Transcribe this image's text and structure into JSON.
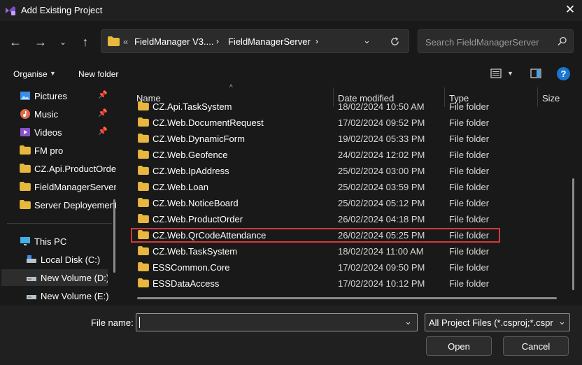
{
  "window": {
    "title": "Add Existing Project",
    "close_icon": "close-icon"
  },
  "nav": {
    "path_overflow": "«",
    "crumbs": [
      "FieldManager V3....",
      "FieldManagerServer"
    ],
    "search_placeholder": "Search FieldManagerServer"
  },
  "toolbar": {
    "organise": "Organise",
    "new_folder": "New folder"
  },
  "sidebar": {
    "items": [
      {
        "label": "Pictures",
        "icon": "pictures-icon",
        "pinned": true
      },
      {
        "label": "Music",
        "icon": "music-icon",
        "pinned": true
      },
      {
        "label": "Videos",
        "icon": "videos-icon",
        "pinned": true
      },
      {
        "label": "FM pro",
        "icon": "folder-icon",
        "pinned": false
      },
      {
        "label": "CZ.Api.ProductOrder",
        "icon": "folder-icon",
        "pinned": false
      },
      {
        "label": "FieldManagerServer",
        "icon": "folder-icon",
        "pinned": false
      },
      {
        "label": "Server Deployement",
        "icon": "folder-icon",
        "pinned": false
      }
    ],
    "this_pc": "This PC",
    "drives": [
      {
        "label": "Local Disk (C:)"
      },
      {
        "label": "New Volume (D:)"
      },
      {
        "label": "New Volume (E:)"
      }
    ]
  },
  "columns": {
    "name": "Name",
    "date": "Date modified",
    "type": "Type",
    "size": "Size"
  },
  "files": [
    {
      "name": "CZ.Api.TaskSystem",
      "date": "18/02/2024 10:50 AM",
      "type": "File folder"
    },
    {
      "name": "CZ.Web.DocumentRequest",
      "date": "17/02/2024 09:52 PM",
      "type": "File folder"
    },
    {
      "name": "CZ.Web.DynamicForm",
      "date": "19/02/2024 05:33 PM",
      "type": "File folder"
    },
    {
      "name": "CZ.Web.Geofence",
      "date": "24/02/2024 12:02 PM",
      "type": "File folder"
    },
    {
      "name": "CZ.Web.IpAddress",
      "date": "25/02/2024 03:00 PM",
      "type": "File folder"
    },
    {
      "name": "CZ.Web.Loan",
      "date": "25/02/2024 03:59 PM",
      "type": "File folder"
    },
    {
      "name": "CZ.Web.NoticeBoard",
      "date": "25/02/2024 05:12 PM",
      "type": "File folder"
    },
    {
      "name": "CZ.Web.ProductOrder",
      "date": "26/02/2024 04:18 PM",
      "type": "File folder"
    },
    {
      "name": "CZ.Web.QrCodeAttendance",
      "date": "26/02/2024 05:25 PM",
      "type": "File folder"
    },
    {
      "name": "CZ.Web.TaskSystem",
      "date": "18/02/2024 11:00 AM",
      "type": "File folder"
    },
    {
      "name": "ESSCommon.Core",
      "date": "17/02/2024 09:50 PM",
      "type": "File folder"
    },
    {
      "name": "ESSDataAccess",
      "date": "17/02/2024 10:12 PM",
      "type": "File folder"
    }
  ],
  "highlighted_file": "CZ.Web.QrCodeAttendance",
  "bottom": {
    "file_name_label": "File name:",
    "file_name_value": "",
    "filter": "All Project Files (*.csproj;*.csproj)",
    "open": "Open",
    "cancel": "Cancel"
  },
  "colors": {
    "folder": "#e8b73d",
    "highlight_border": "#d23a3a",
    "accent": "#0078d4"
  }
}
